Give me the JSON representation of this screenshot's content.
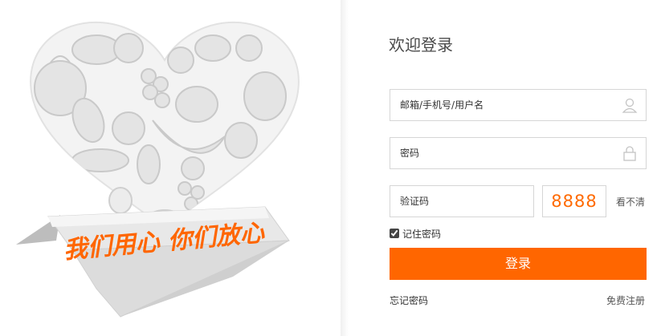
{
  "illustration": {
    "slogan": "我们用心 你们放心",
    "accent_color": "#ff6600"
  },
  "login": {
    "title": "欢迎登录",
    "username_placeholder": "邮箱/手机号/用户名",
    "password_placeholder": "密码",
    "captcha_placeholder": "验证码",
    "captcha_code": "8888",
    "refresh_label": "看不清",
    "remember_label": "记住密码",
    "remember_checked": true,
    "submit_label": "登录",
    "forgot_label": "忘记密码",
    "register_label": "免费注册"
  },
  "colors": {
    "brand": "#ff6600",
    "captcha_text": "#ff6a00",
    "border": "#d6d6d6"
  }
}
